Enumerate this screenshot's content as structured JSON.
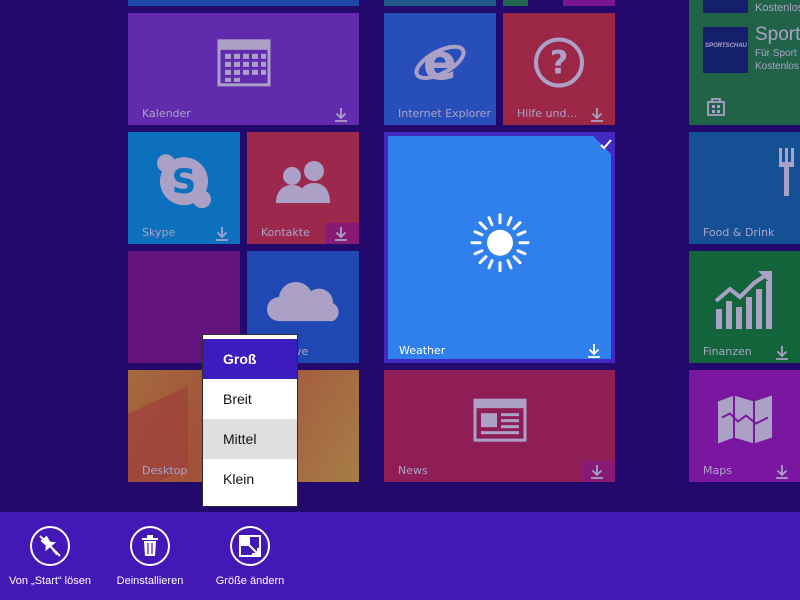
{
  "tiles": {
    "kalender": "Kalender",
    "internet_explorer": "Internet Explorer",
    "hilfe": "Hilfe und…",
    "skype": "Skype",
    "kontakte": "Kontakte",
    "onedrive_partial": "ve",
    "weather": "Weather",
    "food": "Food & Drink",
    "finanzen": "Finanzen",
    "desktop": "Desktop",
    "news": "News",
    "maps": "Maps"
  },
  "store_tile": {
    "line1": "Kostenlos",
    "headline": "Sport",
    "logo_text": "SPORTSCHAU",
    "line2": "Für Sport",
    "line3": "Kostenlos"
  },
  "size_menu": {
    "options": [
      "Groß",
      "Breit",
      "Mittel",
      "Klein"
    ],
    "selected": "Groß"
  },
  "app_bar": {
    "unpin": "Von „Start“ lösen",
    "uninstall": "Deinstallieren",
    "resize": "Größe ändern"
  },
  "colors": {
    "background": "#22096b",
    "app_bar": "#4417b7",
    "selected_menu": "#3c1bbf",
    "weather": "#2f80ec"
  }
}
